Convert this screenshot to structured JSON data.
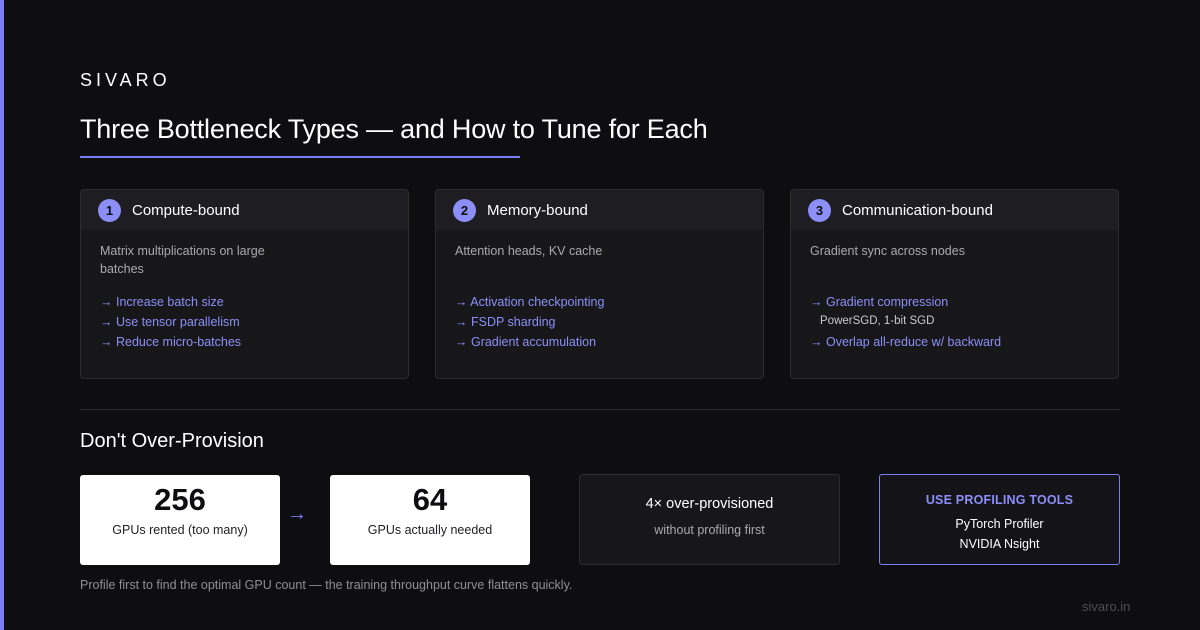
{
  "brand": "SIVARO",
  "title": "Three Bottleneck Types — and How to Tune for Each",
  "colors": {
    "background": "#0e0e10",
    "accent": "#7b7ff5",
    "card": "#17171a",
    "muted_text": "#a9a9b0"
  },
  "cards": [
    {
      "number": "1",
      "title": "Compute-bound",
      "description": "Matrix multiplications on large batches",
      "tips": [
        {
          "text": "→ Increase batch size"
        },
        {
          "text": "→ Use tensor parallelism"
        },
        {
          "text": "→ Reduce micro-batches"
        }
      ]
    },
    {
      "number": "2",
      "title": "Memory-bound",
      "description": "Attention heads, KV cache",
      "tips": [
        {
          "text": "→ Activation checkpointing"
        },
        {
          "text": "→ FSDP sharding"
        },
        {
          "text": "→ Gradient accumulation"
        }
      ]
    },
    {
      "number": "3",
      "title": "Communication-bound",
      "description": "Gradient sync across nodes",
      "tips": [
        {
          "text": "→ Gradient compression",
          "note": "PowerSGD, 1-bit SGD"
        },
        {
          "text": "→ Overlap all-reduce w/ backward"
        }
      ]
    }
  ],
  "section": {
    "title": "Don't Over-Provision",
    "rented": {
      "value": "256",
      "label": "GPUs rented (too many)"
    },
    "arrow": "→",
    "needed": {
      "value": "64",
      "label": "GPUs actually needed"
    },
    "overprovision": {
      "title": "4× over-provisioned",
      "subtitle": "without profiling first"
    },
    "tools": {
      "title": "USE PROFILING TOOLS",
      "items": [
        "PyTorch Profiler",
        "NVIDIA Nsight"
      ]
    },
    "footnote": "Profile first to find the optimal GPU count — the training throughput curve flattens quickly."
  },
  "footer": {
    "url": "sivaro.in"
  }
}
